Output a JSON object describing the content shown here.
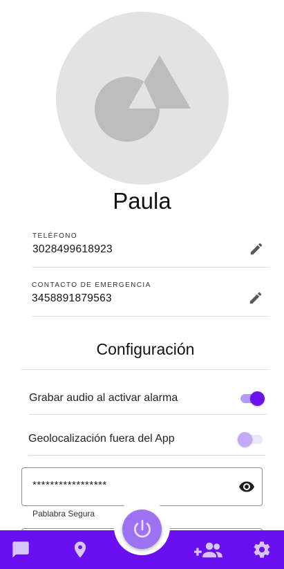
{
  "profile": {
    "name": "Paula"
  },
  "phone": {
    "label": "TELÉFONO",
    "value": "3028499618923"
  },
  "emergency": {
    "label": "CONTACTO DE EMERGENCIA",
    "value": "3458891879563"
  },
  "settings": {
    "title": "Configuración",
    "record_audio": {
      "label": "Grabar audio al activar alarma",
      "enabled": true
    },
    "geolocation": {
      "label": "Geolocalización fuera del App",
      "enabled": false
    }
  },
  "safe_word": {
    "value": "*****************",
    "helper": "Pablabra Segura"
  },
  "colors": {
    "primary": "#6a10f0",
    "fab": "#9c72f3",
    "avatar_bg": "#e3e3e3"
  },
  "icons": {
    "nav": [
      "chat-icon",
      "location-pin-icon",
      "power-icon",
      "group-add-icon",
      "settings-gear-icon"
    ]
  }
}
